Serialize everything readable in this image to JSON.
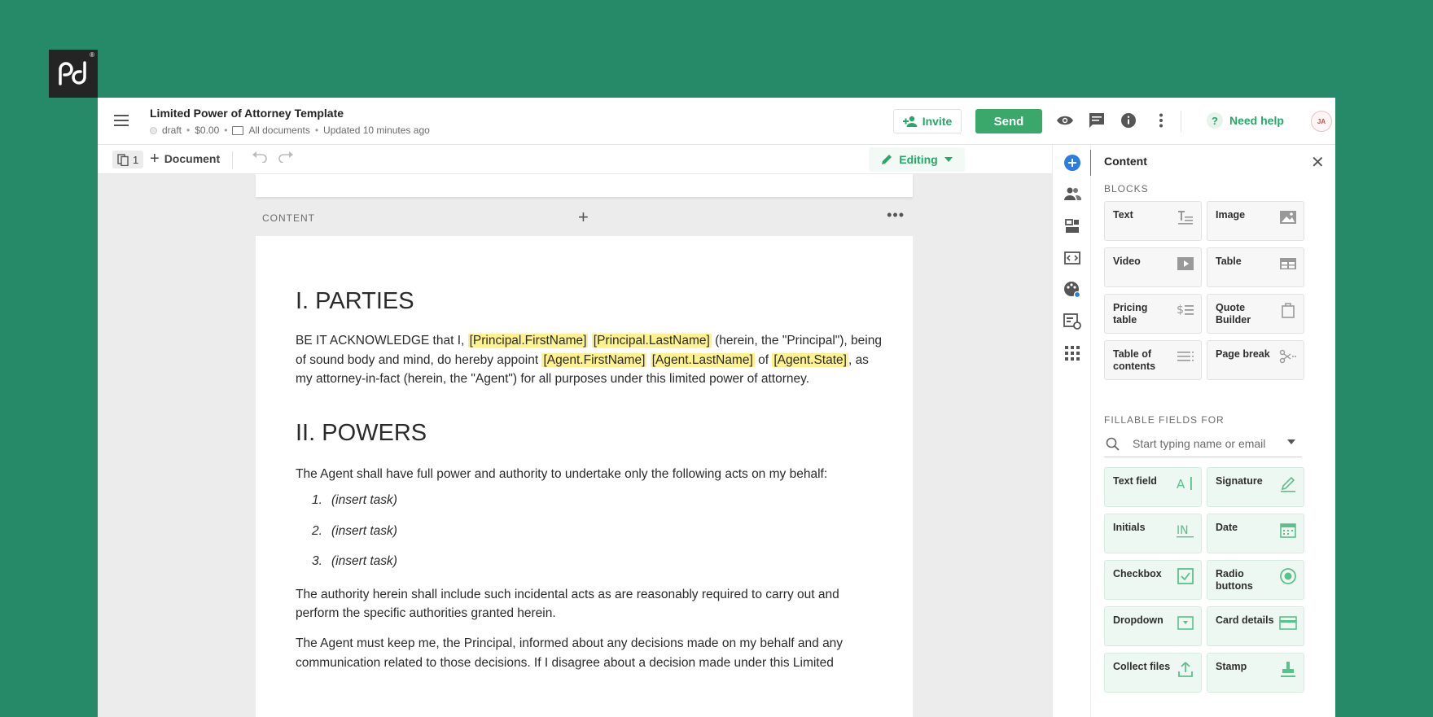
{
  "header": {
    "title": "Limited Power of Attorney Template",
    "status": "draft",
    "price": "$0.00",
    "folder": "All documents",
    "updated": "Updated 10 minutes ago",
    "invite_label": "Invite",
    "send_label": "Send",
    "help_label": "Need help",
    "avatar_initials": "JA"
  },
  "toolbar": {
    "page_count": "1",
    "add_document_label": "Document",
    "mode_label": "Editing"
  },
  "editor": {
    "block_label": "CONTENT",
    "heading1": "I. PARTIES",
    "parties": {
      "t1": "BE IT ACKNOWLEDGE that I, ",
      "tok1": "[Principal.FirstName]",
      "tok2": "[Principal.LastName]",
      "t2": " (herein, the \"Principal\"), being of sound body and mind, do hereby appoint ",
      "tok3": "[Agent.FirstName]",
      "tok4": "[Agent.LastName]",
      "t3": " of ",
      "tok5": "[Agent.State]",
      "t4": ", as my attorney-in-fact (herein, the \"Agent\") for all purposes under this limited power of attorney."
    },
    "heading2": "II. POWERS",
    "powers_intro": "The Agent shall have full power and authority to undertake only the following acts on my behalf:",
    "tasks": [
      {
        "num": "1.",
        "text": "(insert task)"
      },
      {
        "num": "2.",
        "text": "(insert task)"
      },
      {
        "num": "3.",
        "text": "(insert task)"
      }
    ],
    "para_incidental": "The authority herein shall include such incidental acts as are reasonably required to carry out and perform the specific authorities granted herein.",
    "para_inform": "The Agent must keep me, the Principal, informed about any decisions made on my behalf and any communication related to those decisions. If I disagree about a decision made under this Limited"
  },
  "panel": {
    "title": "Content",
    "blocks_heading": "BLOCKS",
    "blocks": [
      {
        "label": "Text",
        "icon": "text-icon"
      },
      {
        "label": "Image",
        "icon": "image-icon"
      },
      {
        "label": "Video",
        "icon": "video-icon"
      },
      {
        "label": "Table",
        "icon": "table-icon"
      },
      {
        "label": "Pricing table",
        "icon": "pricing-table-icon"
      },
      {
        "label": "Quote Builder",
        "icon": "quote-builder-icon"
      },
      {
        "label": "Table of contents",
        "icon": "table-of-contents-icon"
      },
      {
        "label": "Page break",
        "icon": "page-break-icon"
      }
    ],
    "fields_heading": "FILLABLE FIELDS FOR",
    "search_placeholder": "Start typing name or email",
    "fields": [
      {
        "label": "Text field",
        "icon": "text-field-icon"
      },
      {
        "label": "Signature",
        "icon": "signature-icon"
      },
      {
        "label": "Initials",
        "icon": "initials-icon"
      },
      {
        "label": "Date",
        "icon": "calendar-icon"
      },
      {
        "label": "Checkbox",
        "icon": "checkbox-icon"
      },
      {
        "label": "Radio buttons",
        "icon": "radio-icon"
      },
      {
        "label": "Dropdown",
        "icon": "dropdown-icon"
      },
      {
        "label": "Card details",
        "icon": "card-icon"
      },
      {
        "label": "Collect files",
        "icon": "upload-icon"
      },
      {
        "label": "Stamp",
        "icon": "stamp-icon"
      }
    ]
  },
  "colors": {
    "background": "#268a69",
    "brand_green": "#25a868",
    "send_button": "#3aa86b",
    "token_highlight": "#fdf28d",
    "accent_blue": "#2a7de1"
  }
}
